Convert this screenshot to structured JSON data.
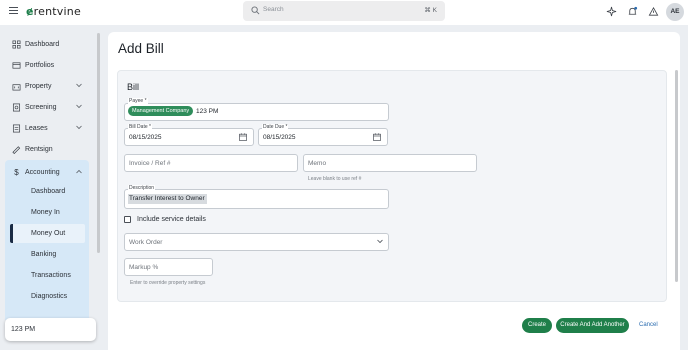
{
  "topbar": {
    "logo": "rentvine",
    "search_placeholder": "Search",
    "search_shortcut": "⌘ K",
    "avatar_initials": "AE"
  },
  "sidebar": {
    "items": [
      {
        "label": "Dashboard",
        "icon": "dashboard-icon"
      },
      {
        "label": "Portfolios",
        "icon": "portfolio-icon"
      },
      {
        "label": "Property",
        "icon": "property-icon"
      },
      {
        "label": "Screening",
        "icon": "screening-icon"
      },
      {
        "label": "Leases",
        "icon": "leases-icon"
      },
      {
        "label": "Rentsign",
        "icon": "rentsign-icon"
      }
    ],
    "accounting": {
      "label": "Accounting",
      "icon": "dollar-icon",
      "subitems": [
        "Dashboard",
        "Money In",
        "Money Out",
        "Banking",
        "Transactions",
        "Diagnostics"
      ],
      "active": "Money Out"
    },
    "bottom_pill": "123 PM"
  },
  "page": {
    "title": "Add Bill",
    "card_title": "Bill"
  },
  "form": {
    "payee_label": "Payee *",
    "payee_chip": "Management Company",
    "payee_value": "123 PM",
    "bill_date_label": "Bill Date *",
    "bill_date_value": "08/15/2025",
    "date_due_label": "Date Due *",
    "date_due_value": "08/15/2025",
    "invoice_placeholder": "Invoice / Ref #",
    "memo_placeholder": "Memo",
    "memo_helper": "Leave blank to use ref #",
    "description_label": "Description",
    "description_value": "Transfer Interest to Owner",
    "include_service_label": "Include service details",
    "include_service_checked": false,
    "work_order_placeholder": "Work Order",
    "markup_placeholder": "Markup %",
    "markup_helper": "Enter to override property settings"
  },
  "actions": {
    "create": "Create",
    "create_another": "Create And Add Another",
    "cancel": "Cancel"
  },
  "colors": {
    "brand_green": "#1f7f4a",
    "chip_green": "#2f8d5b",
    "accounting_bg": "#d6e8f7",
    "link_blue": "#2b6cb0"
  }
}
